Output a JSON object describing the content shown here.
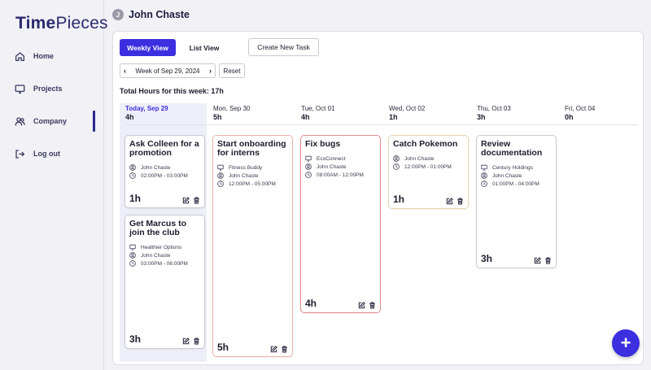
{
  "app": {
    "logo_part1": "Time",
    "logo_part2": "Pieces"
  },
  "sidebar": {
    "items": [
      {
        "label": "Home",
        "icon": "home-icon"
      },
      {
        "label": "Projects",
        "icon": "monitor-icon"
      },
      {
        "label": "Company",
        "icon": "users-icon",
        "active": true
      },
      {
        "label": "Log out",
        "icon": "logout-icon"
      }
    ]
  },
  "header": {
    "avatar_initial": "J",
    "user_name": "John Chaste"
  },
  "toolbar": {
    "weekly_view": "Weekly View",
    "list_view": "List View",
    "create_task": "Create New Task",
    "week_label": "Week of Sep 29, 2024",
    "reset": "Reset",
    "total_hours": "Total Hours for this week: 17h"
  },
  "columns": [
    {
      "day": "Today, Sep 29",
      "hours": "4h",
      "today": true
    },
    {
      "day": "Mon, Sep 30",
      "hours": "5h"
    },
    {
      "day": "Tue, Oct 01",
      "hours": "4h"
    },
    {
      "day": "Wed, Oct 02",
      "hours": "1h"
    },
    {
      "day": "Thu, Oct 03",
      "hours": "3h"
    },
    {
      "day": "Fri, Oct 04",
      "hours": "0h"
    }
  ],
  "tasks": [
    {
      "title": "Ask Colleen for a promotion",
      "project": "",
      "user": "John Chaste",
      "time": "02:00PM - 03:00PM",
      "hours": "1h"
    },
    {
      "title": "Get Marcus to join the club",
      "project": "Healthier Options",
      "user": "John Chaste",
      "time": "03:00PM - 06:00PM",
      "hours": "3h"
    },
    {
      "title": "Start onboarding for interns",
      "project": "Fitness Buddy",
      "user": "John Chaste",
      "time": "12:00PM - 05:00PM",
      "hours": "5h"
    },
    {
      "title": "Fix bugs",
      "project": "EcoConnect",
      "user": "John Chaste",
      "time": "08:00AM - 12:00PM",
      "hours": "4h"
    },
    {
      "title": "Catch Pokemon",
      "project": "",
      "user": "John Chaste",
      "time": "12:00PM - 01:00PM",
      "hours": "1h"
    },
    {
      "title": "Review documentation",
      "project": "Century Holdings",
      "user": "John Chaste",
      "time": "01:00PM - 04:00PM",
      "hours": "3h"
    }
  ],
  "fab": {
    "label": "+"
  },
  "colors": {
    "accent": "#3b2fe0",
    "card_border_orange": "#e8b4a0",
    "card_border_red": "#e48a8a",
    "card_border_yellow": "#e6d6b0"
  }
}
